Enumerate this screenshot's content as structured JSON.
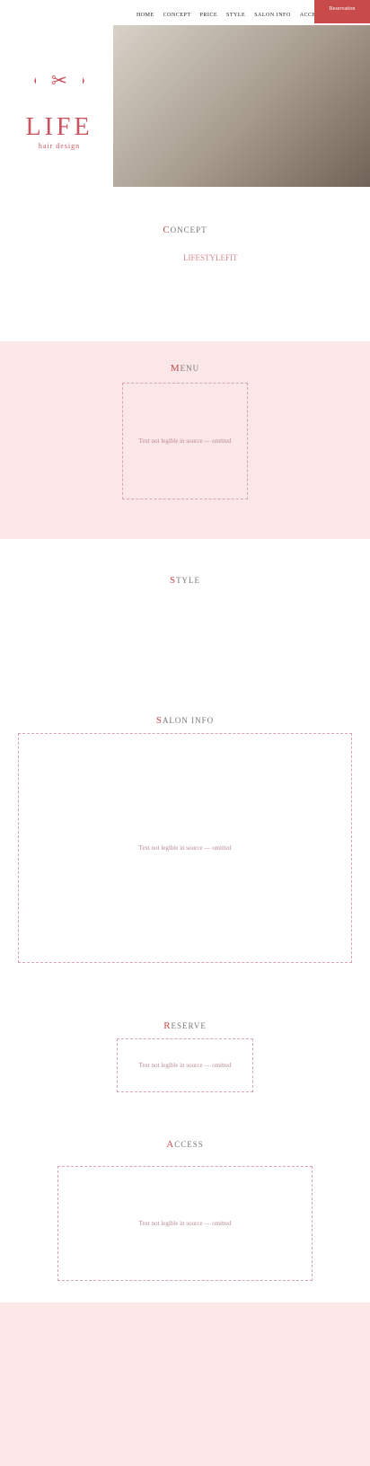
{
  "nav": [
    "HOME",
    "CONCEPT",
    "PRICE",
    "STYLE",
    "SALON INFO",
    "ACCESS"
  ],
  "reservation": "Reservation",
  "logo": {
    "name": "LIFE",
    "sub": "hair design"
  },
  "sections": {
    "concept": {
      "first": "C",
      "rest": "ONCEPT"
    },
    "menu": {
      "first": "M",
      "rest": "ENU"
    },
    "style": {
      "first": "S",
      "rest": "TYLE"
    },
    "salon": {
      "first": "S",
      "rest": "ALON INFO"
    },
    "reserve": {
      "first": "R",
      "rest": "ESERVE"
    },
    "access": {
      "first": "A",
      "rest": "CCESS"
    }
  },
  "concept_heading": "LIFESTYLEFIT",
  "placeholder_note": "Text not legible in source — omitted"
}
